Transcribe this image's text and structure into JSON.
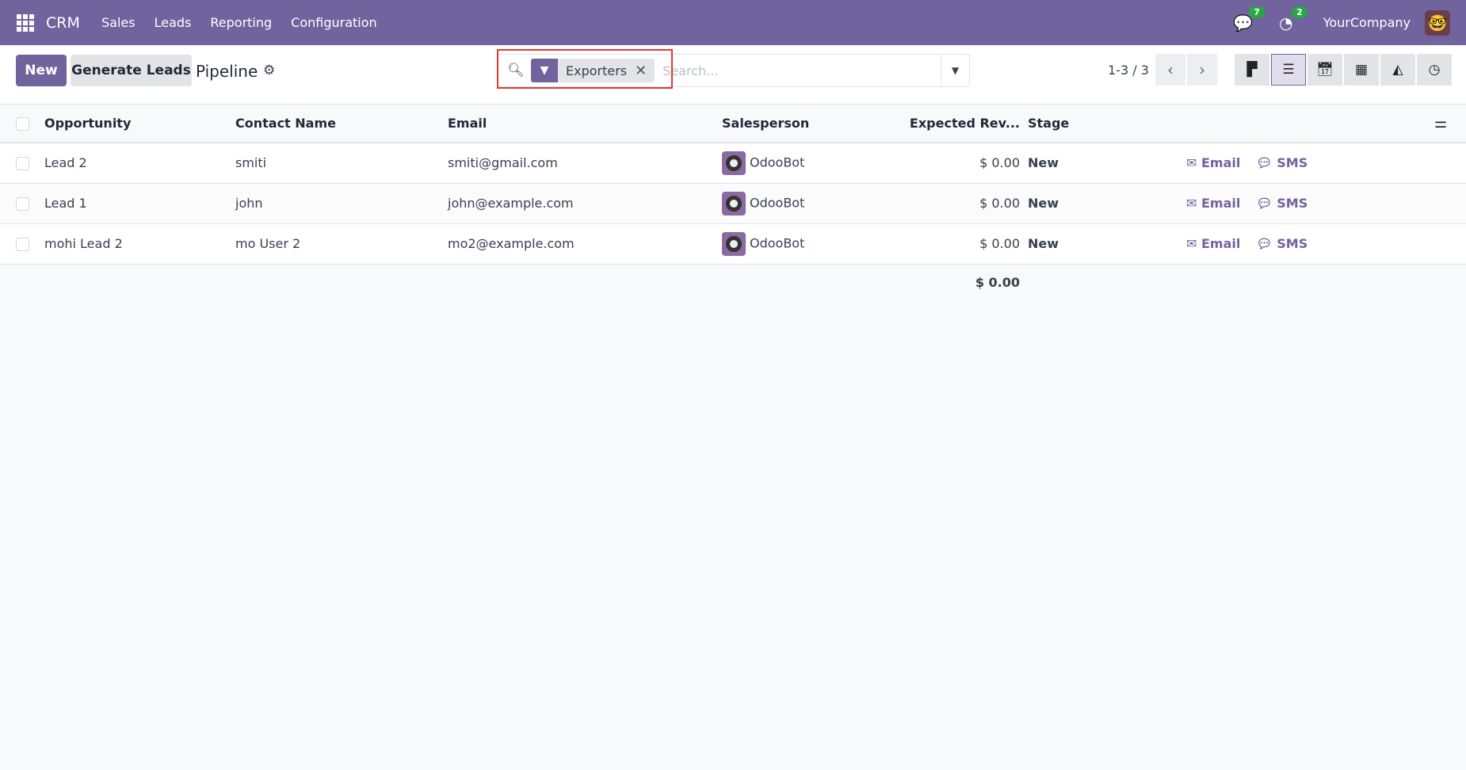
{
  "nav": {
    "app": "CRM",
    "menu": [
      "Sales",
      "Leads",
      "Reporting",
      "Configuration"
    ],
    "messages_count": "7",
    "activities_count": "2",
    "company": "YourCompany"
  },
  "control": {
    "new_label": "New",
    "generate_label": "Generate Leads",
    "title": "Pipeline",
    "facet": "Exporters",
    "search_placeholder": "Search...",
    "pager": "1-3 / 3"
  },
  "table": {
    "headers": [
      "Opportunity",
      "Contact Name",
      "Email",
      "Salesperson",
      "Expected Rev...",
      "Stage"
    ],
    "rows": [
      {
        "opportunity": "Lead 2",
        "contact": "smiti",
        "email": "smiti@gmail.com",
        "salesperson": "OdooBot",
        "revenue": "$ 0.00",
        "stage": "New"
      },
      {
        "opportunity": "Lead 1",
        "contact": "john",
        "email": "john@example.com",
        "salesperson": "OdooBot",
        "revenue": "$ 0.00",
        "stage": "New"
      },
      {
        "opportunity": "mohi Lead 2",
        "contact": "mo User 2",
        "email": "mo2@example.com",
        "salesperson": "OdooBot",
        "revenue": "$ 0.00",
        "stage": "New"
      }
    ],
    "action_email": "Email",
    "action_sms": "SMS",
    "total": "$ 0.00"
  },
  "colors": {
    "brand": "#71639e",
    "badge": "#28a745"
  }
}
